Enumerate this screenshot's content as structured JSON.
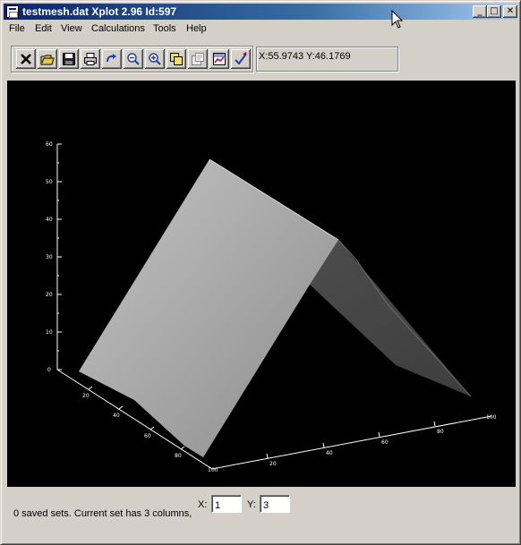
{
  "window": {
    "title": "testmesh.dat Xplot 2.96 Id:597",
    "controls": {
      "minimize": "_",
      "maximize": "□",
      "close": "✕"
    }
  },
  "menu": [
    "File",
    "Edit",
    "View",
    "Calculations",
    "Tools",
    "Help"
  ],
  "toolbar": {
    "tools": [
      "close-icon",
      "open-folder-icon",
      "save-icon",
      "print-icon",
      "redo-icon",
      "zoom-out-icon",
      "zoom-in-icon",
      "copy-icon",
      "properties-icon",
      "chart-icon",
      "check-icon"
    ]
  },
  "coords": "X:55.9743 Y:46.1769",
  "plot": {
    "z_ticks": [
      "0",
      "10",
      "20",
      "30",
      "40",
      "50",
      "60"
    ],
    "y_ticks": [
      "0",
      "20",
      "40",
      "60",
      "80",
      "100"
    ],
    "x_ticks": [
      "0",
      "20",
      "40",
      "60",
      "80",
      "100"
    ],
    "background": "#000000",
    "surface_color": "#a0a0a0"
  },
  "status": {
    "text": "0  saved sets. Current set has  3  columns,",
    "x_label": "X:",
    "x_value": "1",
    "y_label": "Y:",
    "y_value": "3"
  }
}
